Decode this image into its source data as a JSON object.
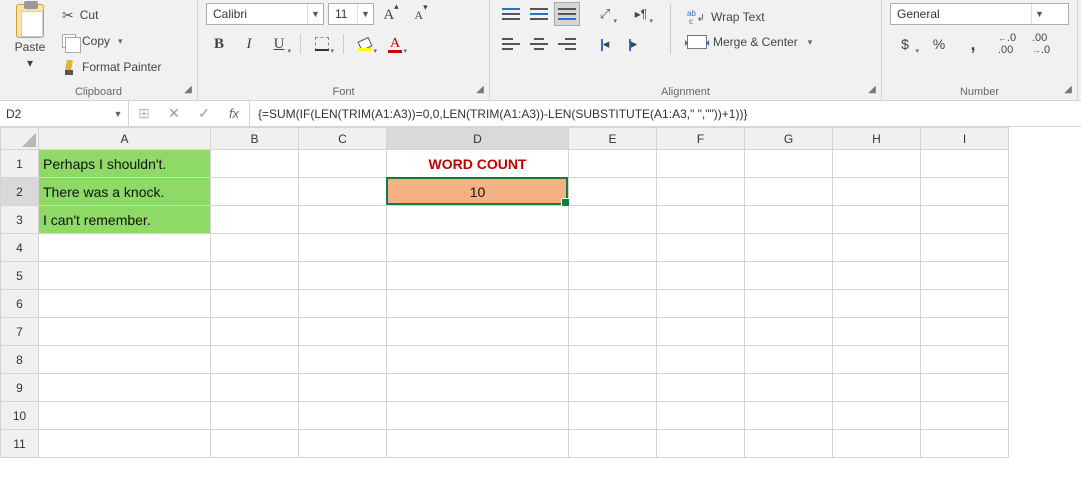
{
  "ribbon": {
    "clipboard": {
      "paste": "Paste",
      "cut": "Cut",
      "copy": "Copy",
      "format_painter": "Format Painter",
      "label": "Clipboard"
    },
    "font": {
      "name": "Calibri",
      "size": "11",
      "label": "Font"
    },
    "alignment": {
      "wrap": "Wrap Text",
      "merge": "Merge & Center",
      "label": "Alignment"
    },
    "number": {
      "format": "General",
      "label": "Number"
    }
  },
  "namebox": "D2",
  "formula": "{=SUM(IF(LEN(TRIM(A1:A3))=0,0,LEN(TRIM(A1:A3))-LEN(SUBSTITUTE(A1:A3,\" \",\"\"))+1))}",
  "columns": [
    "A",
    "B",
    "C",
    "D",
    "E",
    "F",
    "G",
    "H",
    "I"
  ],
  "rows": [
    "1",
    "2",
    "3",
    "4",
    "5",
    "6",
    "7",
    "8",
    "9",
    "10",
    "11"
  ],
  "cells": {
    "A1": "Perhaps I shouldn't.",
    "A2": "There was a knock.",
    "A3": "I can't remember.",
    "D1": "WORD COUNT",
    "D2": "10"
  },
  "selected_col": "D",
  "selected_row": "2"
}
